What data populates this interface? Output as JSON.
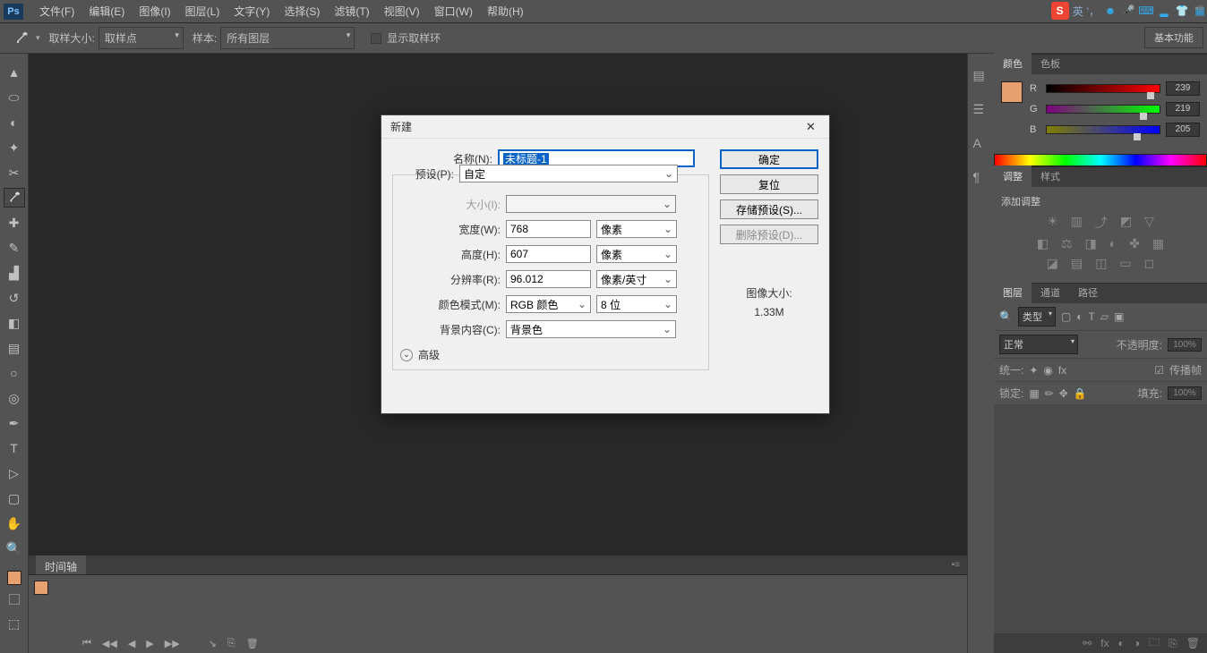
{
  "app": {
    "logo": "Ps"
  },
  "menu": [
    "文件(F)",
    "编辑(E)",
    "图像(I)",
    "图层(L)",
    "文字(Y)",
    "选择(S)",
    "滤镜(T)",
    "视图(V)",
    "窗口(W)",
    "帮助(H)"
  ],
  "optbar": {
    "sample_size_label": "取样大小:",
    "sample_size_value": "取样点",
    "sample_label": "样本:",
    "sample_value": "所有图层",
    "show_ring": "显示取样环"
  },
  "workspace": "基本功能",
  "timeline": {
    "tab": "时间轴"
  },
  "panels": {
    "color": {
      "tabs": [
        "颜色",
        "色板"
      ],
      "r": "R",
      "g": "G",
      "b": "B",
      "rv": "239",
      "gv": "219",
      "bv": "205"
    },
    "adjust": {
      "tabs": [
        "调整",
        "样式"
      ],
      "title": "添加调整"
    },
    "layers": {
      "tabs": [
        "图层",
        "通道",
        "路径"
      ],
      "kind": "类型",
      "blend": "正常",
      "opacity_lbl": "不透明度:",
      "opacity": "100%",
      "unify": "统一:",
      "propagate": "传播帧",
      "lock": "锁定:",
      "fill_lbl": "填充:",
      "fill": "100%"
    }
  },
  "dialog": {
    "title": "新建",
    "name_label": "名称(N):",
    "name_value": "未标题-1",
    "preset_label": "预设(P):",
    "preset_value": "自定",
    "size_label": "大小(I):",
    "width_label": "宽度(W):",
    "width_value": "768",
    "width_unit": "像素",
    "height_label": "高度(H):",
    "height_value": "607",
    "height_unit": "像素",
    "res_label": "分辨率(R):",
    "res_value": "96.012",
    "res_unit": "像素/英寸",
    "mode_label": "颜色模式(M):",
    "mode_value": "RGB 颜色",
    "depth_value": "8 位",
    "bg_label": "背景内容(C):",
    "bg_value": "背景色",
    "advanced": "高级",
    "ok": "确定",
    "reset": "复位",
    "save_preset": "存储预设(S)...",
    "del_preset": "删除预设(D)...",
    "imgsize_label": "图像大小:",
    "imgsize_value": "1.33M"
  },
  "ime": {
    "icon": "S",
    "lang": "英"
  }
}
